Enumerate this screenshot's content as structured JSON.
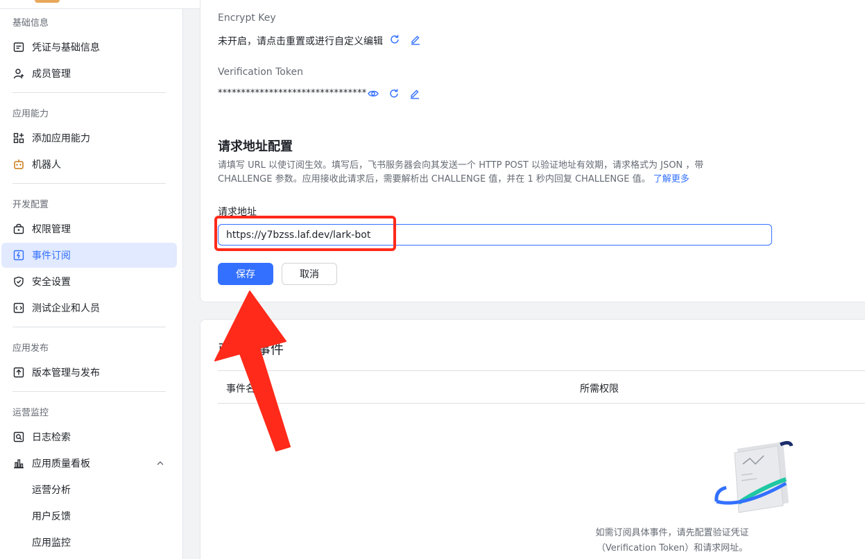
{
  "sidebar": {
    "sections": [
      {
        "title": "基础信息",
        "items": [
          {
            "label": "凭证与基础信息",
            "icon": "credential-icon"
          },
          {
            "label": "成员管理",
            "icon": "member-icon"
          }
        ]
      },
      {
        "title": "应用能力",
        "items": [
          {
            "label": "添加应用能力",
            "icon": "add-capability-icon"
          },
          {
            "label": "机器人",
            "icon": "robot-icon"
          }
        ]
      },
      {
        "title": "开发配置",
        "items": [
          {
            "label": "权限管理",
            "icon": "permission-icon"
          },
          {
            "label": "事件订阅",
            "icon": "event-icon",
            "active": true
          },
          {
            "label": "安全设置",
            "icon": "shield-icon"
          },
          {
            "label": "测试企业和人员",
            "icon": "code-icon"
          }
        ]
      },
      {
        "title": "应用发布",
        "items": [
          {
            "label": "版本管理与发布",
            "icon": "upload-icon"
          }
        ]
      },
      {
        "title": "运营监控",
        "items": [
          {
            "label": "日志检索",
            "icon": "log-search-icon"
          },
          {
            "label": "应用质量看板",
            "icon": "chart-icon"
          }
        ]
      }
    ],
    "sub_items": [
      "运营分析",
      "用户反馈",
      "应用监控"
    ]
  },
  "encrypt": {
    "label": "Encrypt Key",
    "value": "未开启，请点击重置或进行自定义编辑"
  },
  "token": {
    "label": "Verification Token",
    "value": "********************************"
  },
  "request": {
    "title": "请求地址配置",
    "desc_line1": "请填写 URL 以使订阅生效。填写后，飞书服务器会向其发送一个 HTTP POST 以验证地址有效期，请求格式为 JSON ，带",
    "desc_line2": "CHALLENGE 参数。应用接收此请求后，需要解析出 CHALLENGE 值，并在 1 秒内回复 CHALLENGE 值。",
    "learn_more": "了解更多",
    "field_label": "请求地址",
    "url_value": "https://y7bzss.laf.dev/lark-bot",
    "save_label": "保存",
    "cancel_label": "取消"
  },
  "events": {
    "title": "已添加事件",
    "col_name": "事件名称",
    "col_perm": "所需权限",
    "empty_line1": "如需订阅具体事件，请先配置验证凭证",
    "empty_line2": "（Verification Token）和请求网址。"
  },
  "colors": {
    "primary": "#3370ff",
    "annotation_red": "#ff2a1a",
    "active_bg": "#e1eaff"
  }
}
